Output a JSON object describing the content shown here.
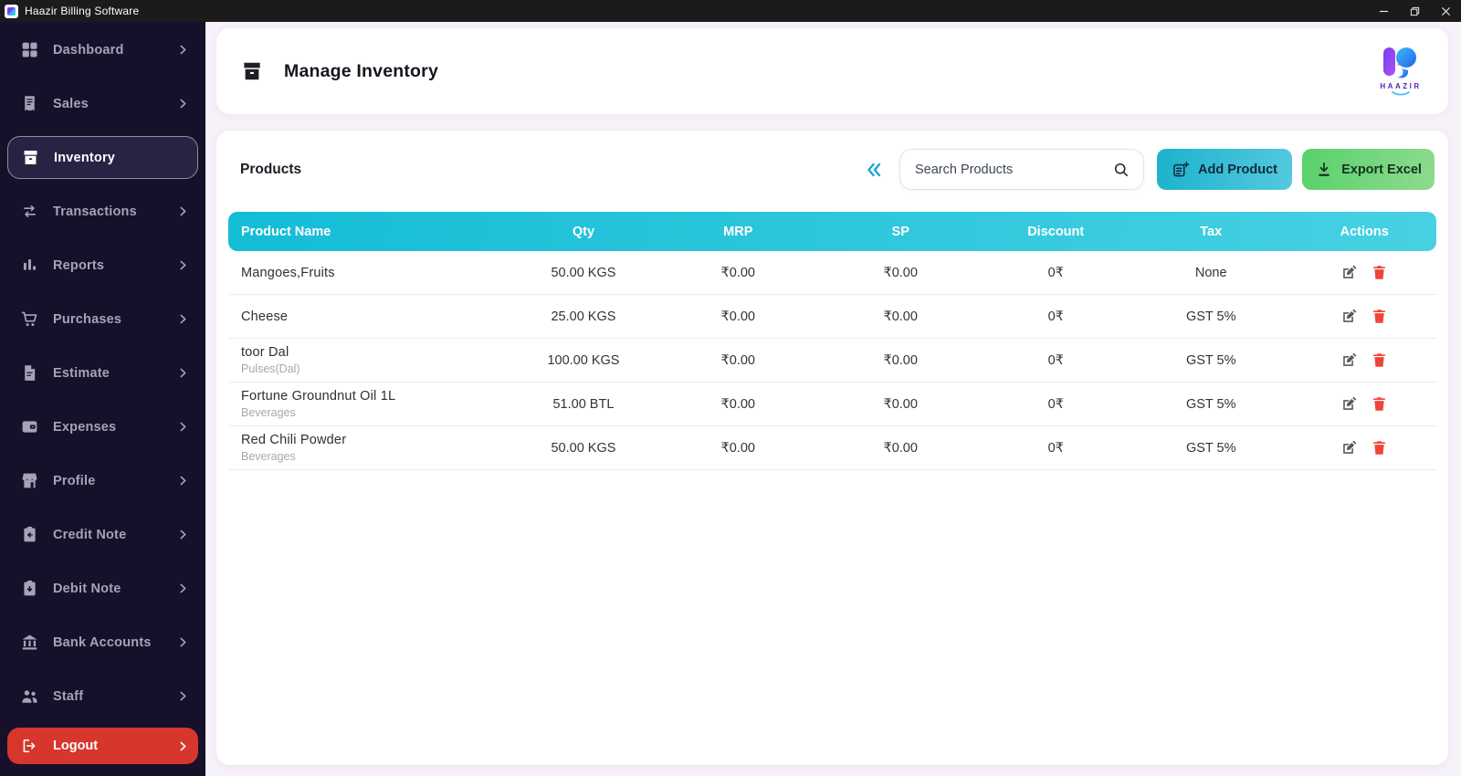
{
  "window": {
    "title": "Haazir Billing Software",
    "controls": {
      "minimize": "minimize-icon",
      "restore": "restore-icon",
      "close": "close-icon"
    }
  },
  "sidebar": {
    "items": [
      {
        "label": "Dashboard",
        "icon": "dashboard-icon"
      },
      {
        "label": "Sales",
        "icon": "sales-icon"
      },
      {
        "label": "Inventory",
        "icon": "inventory-icon",
        "active": true
      },
      {
        "label": "Transactions",
        "icon": "transactions-icon"
      },
      {
        "label": "Reports",
        "icon": "reports-icon"
      },
      {
        "label": "Purchases",
        "icon": "purchases-icon"
      },
      {
        "label": "Estimate",
        "icon": "estimate-icon"
      },
      {
        "label": "Expenses",
        "icon": "expenses-icon"
      },
      {
        "label": "Profile",
        "icon": "profile-icon"
      },
      {
        "label": "Credit Note",
        "icon": "credit-note-icon"
      },
      {
        "label": "Debit Note",
        "icon": "debit-note-icon"
      },
      {
        "label": "Bank Accounts",
        "icon": "bank-icon"
      },
      {
        "label": "Staff",
        "icon": "staff-icon"
      }
    ],
    "logout_label": "Logout"
  },
  "header": {
    "title": "Manage Inventory",
    "logo_text": "HAAZIR"
  },
  "products": {
    "section_title": "Products",
    "search_placeholder": "Search Products",
    "add_button": "Add Product",
    "export_button": "Export Excel",
    "table": {
      "headers": [
        "Product Name",
        "Qty",
        "MRP",
        "SP",
        "Discount",
        "Tax",
        "Actions"
      ],
      "rows": [
        {
          "name": "Mangoes,Fruits",
          "category": "",
          "qty": "50.00 KGS",
          "mrp": "₹0.00",
          "sp": "₹0.00",
          "discount": "0₹",
          "tax": "None"
        },
        {
          "name": "Cheese",
          "category": "",
          "qty": "25.00 KGS",
          "mrp": "₹0.00",
          "sp": "₹0.00",
          "discount": "0₹",
          "tax": "GST 5%"
        },
        {
          "name": "toor Dal",
          "category": "Pulses(Dal)",
          "qty": "100.00 KGS",
          "mrp": "₹0.00",
          "sp": "₹0.00",
          "discount": "0₹",
          "tax": "GST 5%"
        },
        {
          "name": "Fortune Groundnut Oil 1L",
          "category": "Beverages",
          "qty": "51.00 BTL",
          "mrp": "₹0.00",
          "sp": "₹0.00",
          "discount": "0₹",
          "tax": "GST 5%"
        },
        {
          "name": "Red Chili Powder",
          "category": "Beverages",
          "qty": "50.00 KGS",
          "mrp": "₹0.00",
          "sp": "₹0.00",
          "discount": "0₹",
          "tax": "GST 5%"
        }
      ]
    }
  },
  "colors": {
    "titlebar": "#1b1b1b",
    "sidebar_bg": "#16102b",
    "sidebar_text": "#a7a2b6",
    "active_item_bg": "#2a2243",
    "logout_red": "#d6362c",
    "main_bg": "#f7f1f9",
    "table_header_gradient": [
      "#14bcd6",
      "#47d1e2"
    ],
    "add_button_gradient": [
      "#1cb2cd",
      "#55c9df"
    ],
    "export_button_gradient": [
      "#58d16c",
      "#8edb8d"
    ],
    "delete_red": "#ef4438",
    "edit_gray": "#5a5a5a",
    "collapse_blue": "#18a6d9"
  }
}
